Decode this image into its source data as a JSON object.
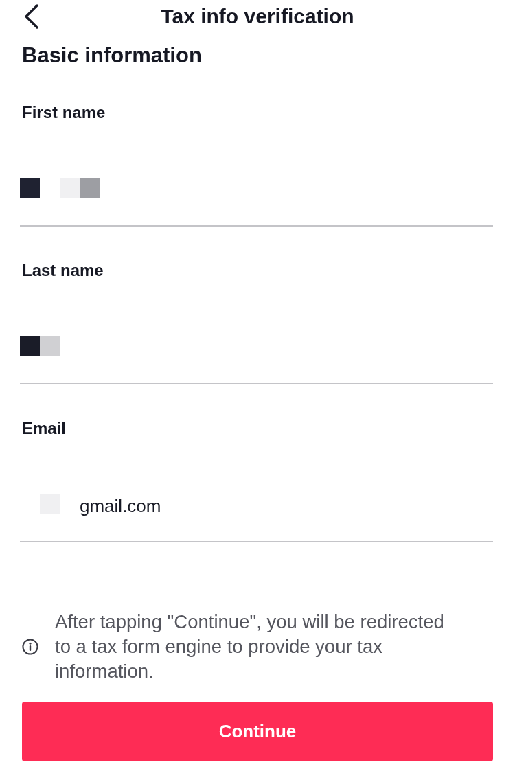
{
  "header": {
    "title": "Tax info verification"
  },
  "section": {
    "title": "Basic information"
  },
  "fields": [
    {
      "label": "First name",
      "masked_tiles": [
        {
          "kind": "tile",
          "color": "#1f2231"
        },
        {
          "kind": "blank"
        },
        {
          "kind": "tile",
          "color": "#f0f0f2"
        },
        {
          "kind": "tile",
          "color": "#9d9ea3"
        }
      ]
    },
    {
      "label": "Last name",
      "masked_tiles": [
        {
          "kind": "tile",
          "color": "#1a1c28"
        },
        {
          "kind": "tile",
          "color": "#d0d0d3"
        }
      ]
    },
    {
      "label": "Email",
      "masked_tiles": [
        {
          "kind": "blank"
        },
        {
          "kind": "tile",
          "color": "#f0f0f2"
        },
        {
          "kind": "blank"
        }
      ],
      "value": "gmail.com"
    }
  ],
  "notice": {
    "text": "After tapping \"Continue\", you will be redirected to a tax form engine to provide your tax information."
  },
  "button": {
    "label": "Continue"
  }
}
